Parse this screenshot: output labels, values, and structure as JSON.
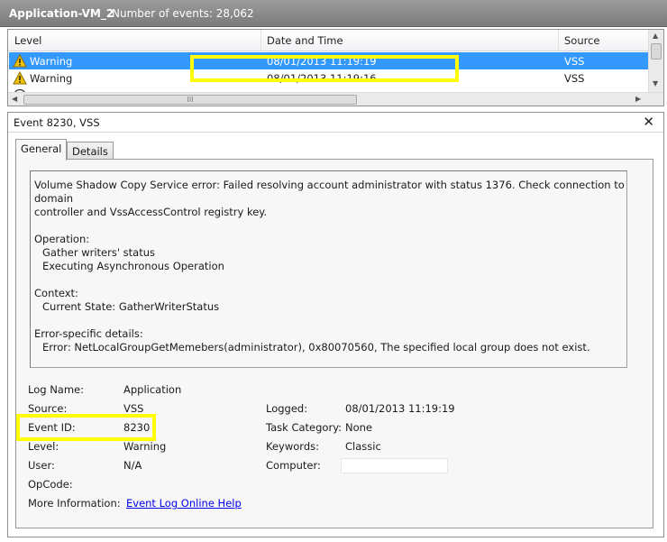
{
  "titlebar": {
    "title": "Application-VM_2",
    "event_count": "Number of events: 28,062"
  },
  "list": {
    "columns": [
      "Level",
      "Date and Time",
      "Source"
    ],
    "rows": [
      {
        "level": "Warning",
        "datetime": "08/01/2013 11:19:19",
        "source": "VSS",
        "selected": true
      },
      {
        "level": "Warning",
        "datetime": "08/01/2013 11:19:16",
        "source": "VSS",
        "selected": false
      }
    ],
    "scroll_grip": "III"
  },
  "details": {
    "title": "Event 8230, VSS",
    "close_icon": "close-icon",
    "tabs": [
      "General",
      "Details"
    ],
    "active_tab": "General",
    "description": {
      "line1_pre": "Volume Shadow Copy Service error: ",
      "line1_hl": "Failed resolving account administrator with status 1376",
      "line1_post": ". Check connection to domain",
      "line2": "controller and VssAccessControl registry key.",
      "op_label": "Operation:",
      "op1": "Gather writers' status",
      "op2": "Executing Asynchronous Operation",
      "ctx_label": "Context:",
      "ctx1": "Current State: GatherWriterStatus",
      "err_label": "Error-specific details:",
      "err1": "Error: NetLocalGroupGetMemebers(administrator), 0x80070560, The specified local group does not exist."
    },
    "props": {
      "log_name_label": "Log Name:",
      "log_name": "Application",
      "source_label": "Source:",
      "source": "VSS",
      "event_id_label": "Event ID:",
      "event_id": "8230",
      "level_label": "Level:",
      "level": "Warning",
      "user_label": "User:",
      "user": "N/A",
      "opcode_label": "OpCode:",
      "more_info_label": "More Information:",
      "more_info_link": "Event Log Online Help",
      "logged_label": "Logged:",
      "logged": "08/01/2013 11:19:19",
      "task_category_label": "Task Category:",
      "task_category": "None",
      "keywords_label": "Keywords:",
      "keywords": "Classic",
      "computer_label": "Computer:"
    }
  },
  "colors": {
    "selection": "#3399ff",
    "highlight": "#ffff00",
    "link": "#0000ee"
  }
}
